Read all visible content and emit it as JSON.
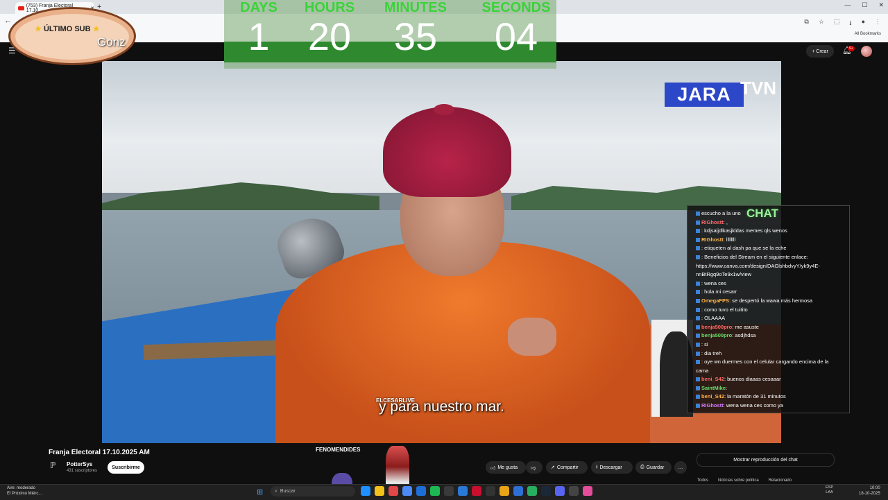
{
  "browser": {
    "tab_title": "(753) Franja Electoral 17.10...",
    "new_tab": "+",
    "bookmarks_label": "All Bookmarks"
  },
  "youtube": {
    "create_label": "Crear",
    "notif_badge": "9+"
  },
  "countdown": {
    "labels": {
      "days": "DAYS",
      "hours": "HOURS",
      "minutes": "MINUTES",
      "seconds": "SECONDS"
    },
    "values": {
      "days": "1",
      "hours": "20",
      "minutes": "35",
      "seconds": "04"
    }
  },
  "sub_sticker": {
    "label": "ÚLTIMO SUB",
    "name": "Gonz"
  },
  "video": {
    "logo_text": "JARA",
    "network_text": "TVN",
    "subtitle": "y para nuestro mar.",
    "streamer_tag": "ELCESARLIVE"
  },
  "chat": {
    "title": "CHAT",
    "lines": [
      {
        "user": "",
        "msg": "escucho a la uno"
      },
      {
        "user": "RIGhostt",
        "msg": ": ,"
      },
      {
        "user": "",
        "msg": ": kdjsaljdlkasjkldas memes qls wenos"
      },
      {
        "user": "RIGhostt",
        "msg": ": llllllll"
      },
      {
        "user": "",
        "msg": ": etiqueten al dash pa que se la eche"
      },
      {
        "user": "",
        "msg": ": Beneficios del Stream en el siguiente enlace: https://www.canva.com/design/DAGlshbdvyY/yk9y4E-nnBtRgq9oTe9x1w/view"
      },
      {
        "user": "",
        "msg": ": wena ces"
      },
      {
        "user": "",
        "msg": ": hola mi cesarr"
      },
      {
        "user": "OmegaFPS",
        "msg": ": se despertó la wawa más hermosa"
      },
      {
        "user": "",
        "msg": ": como tuvo el tuitito"
      },
      {
        "user": "",
        "msg": ": OLAAAA"
      },
      {
        "user": "benja500pro",
        "msg": ": me asuste"
      },
      {
        "user": "benja500pro",
        "msg": ": asdjhdsa"
      },
      {
        "user": "",
        "msg": ": si"
      },
      {
        "user": "",
        "msg": ": dia treh"
      },
      {
        "user": "",
        "msg": ": oye wn duermes con el celular cargando encima de la cama"
      },
      {
        "user": "beni_S42",
        "msg": ": buenos diaaas cesaaar"
      },
      {
        "user": "SaintMike",
        "msg": ":"
      },
      {
        "user": "beni_S42",
        "msg": ": la maratón de 31 minutos"
      },
      {
        "user": "RIGhostt",
        "msg": ": wena wena ces como ya"
      }
    ]
  },
  "below": {
    "video_title": "Franja Electoral 17.10.2025 AM",
    "channel_name": "PotterSys",
    "subscribers": "431 suscriptores",
    "subscribe_label": "Suscribirme",
    "like_label": "Me gusta",
    "share_label": "Compartir",
    "download_label": "Descargar",
    "save_label": "Guardar",
    "more_label": "…",
    "show_chat_label": "Mostrar reproducción del chat",
    "overlay_name": "FENOMENDIDES",
    "tabs": [
      "Todos",
      "Noticias sobre política",
      "Relacionado"
    ]
  },
  "taskbar": {
    "weather_line1": "Aire: moderado",
    "weather_line2": "El Próximo Miérc...",
    "search_placeholder": "Buscar",
    "lang_line1": "ESP",
    "lang_line2": "LAA",
    "time": "10:00",
    "date": "18-10-2025"
  }
}
